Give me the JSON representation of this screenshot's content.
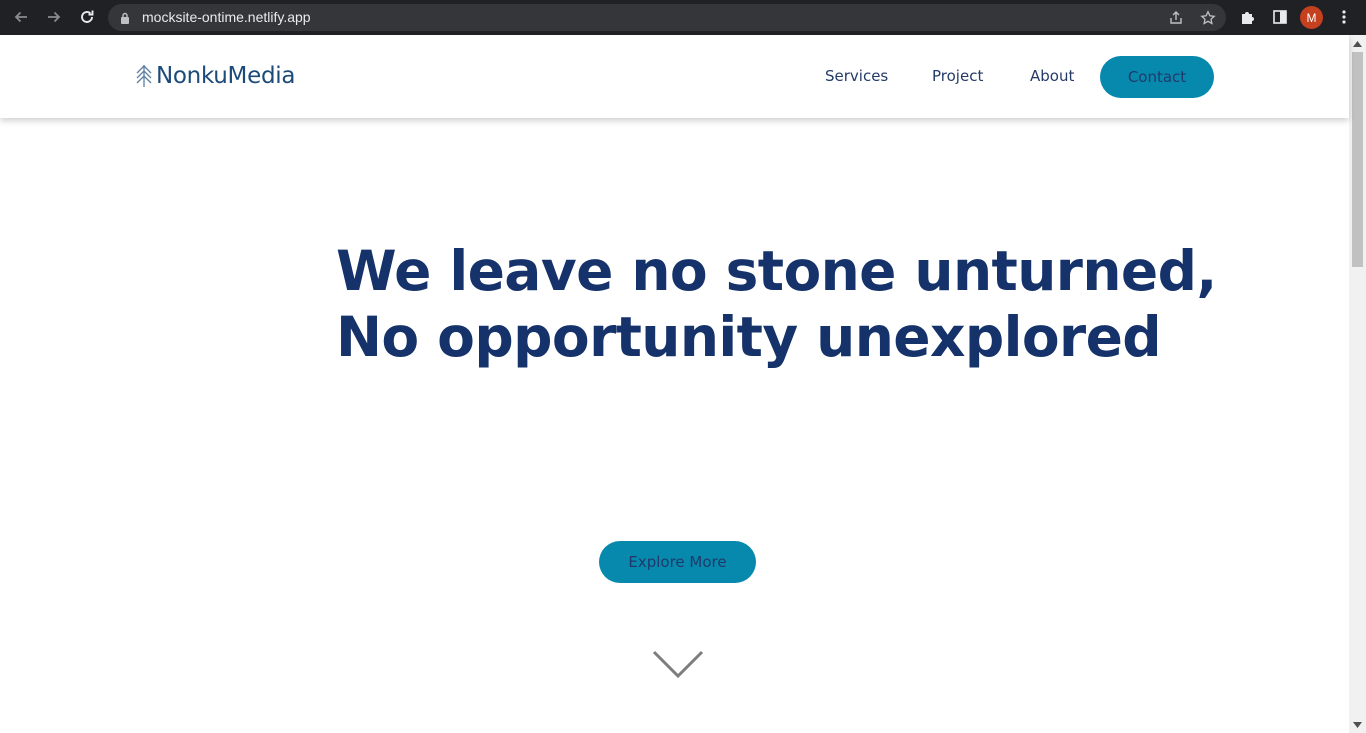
{
  "browser": {
    "url": "mocksite-ontime.netlify.app",
    "profile_initial": "M",
    "profile_color": "#c5401e"
  },
  "site": {
    "logo_text": "NonkuMedia",
    "brand_color": "#1c4a79",
    "accent_color": "#0789ad",
    "nav": {
      "services": "Services",
      "project": "Project",
      "about": "About",
      "contact": "Contact"
    }
  },
  "hero": {
    "line1": "We leave no stone unturned,",
    "line2": "No opportunity unexplored",
    "cta": "Explore More",
    "scroll_icon": "chevron-down-icon"
  }
}
